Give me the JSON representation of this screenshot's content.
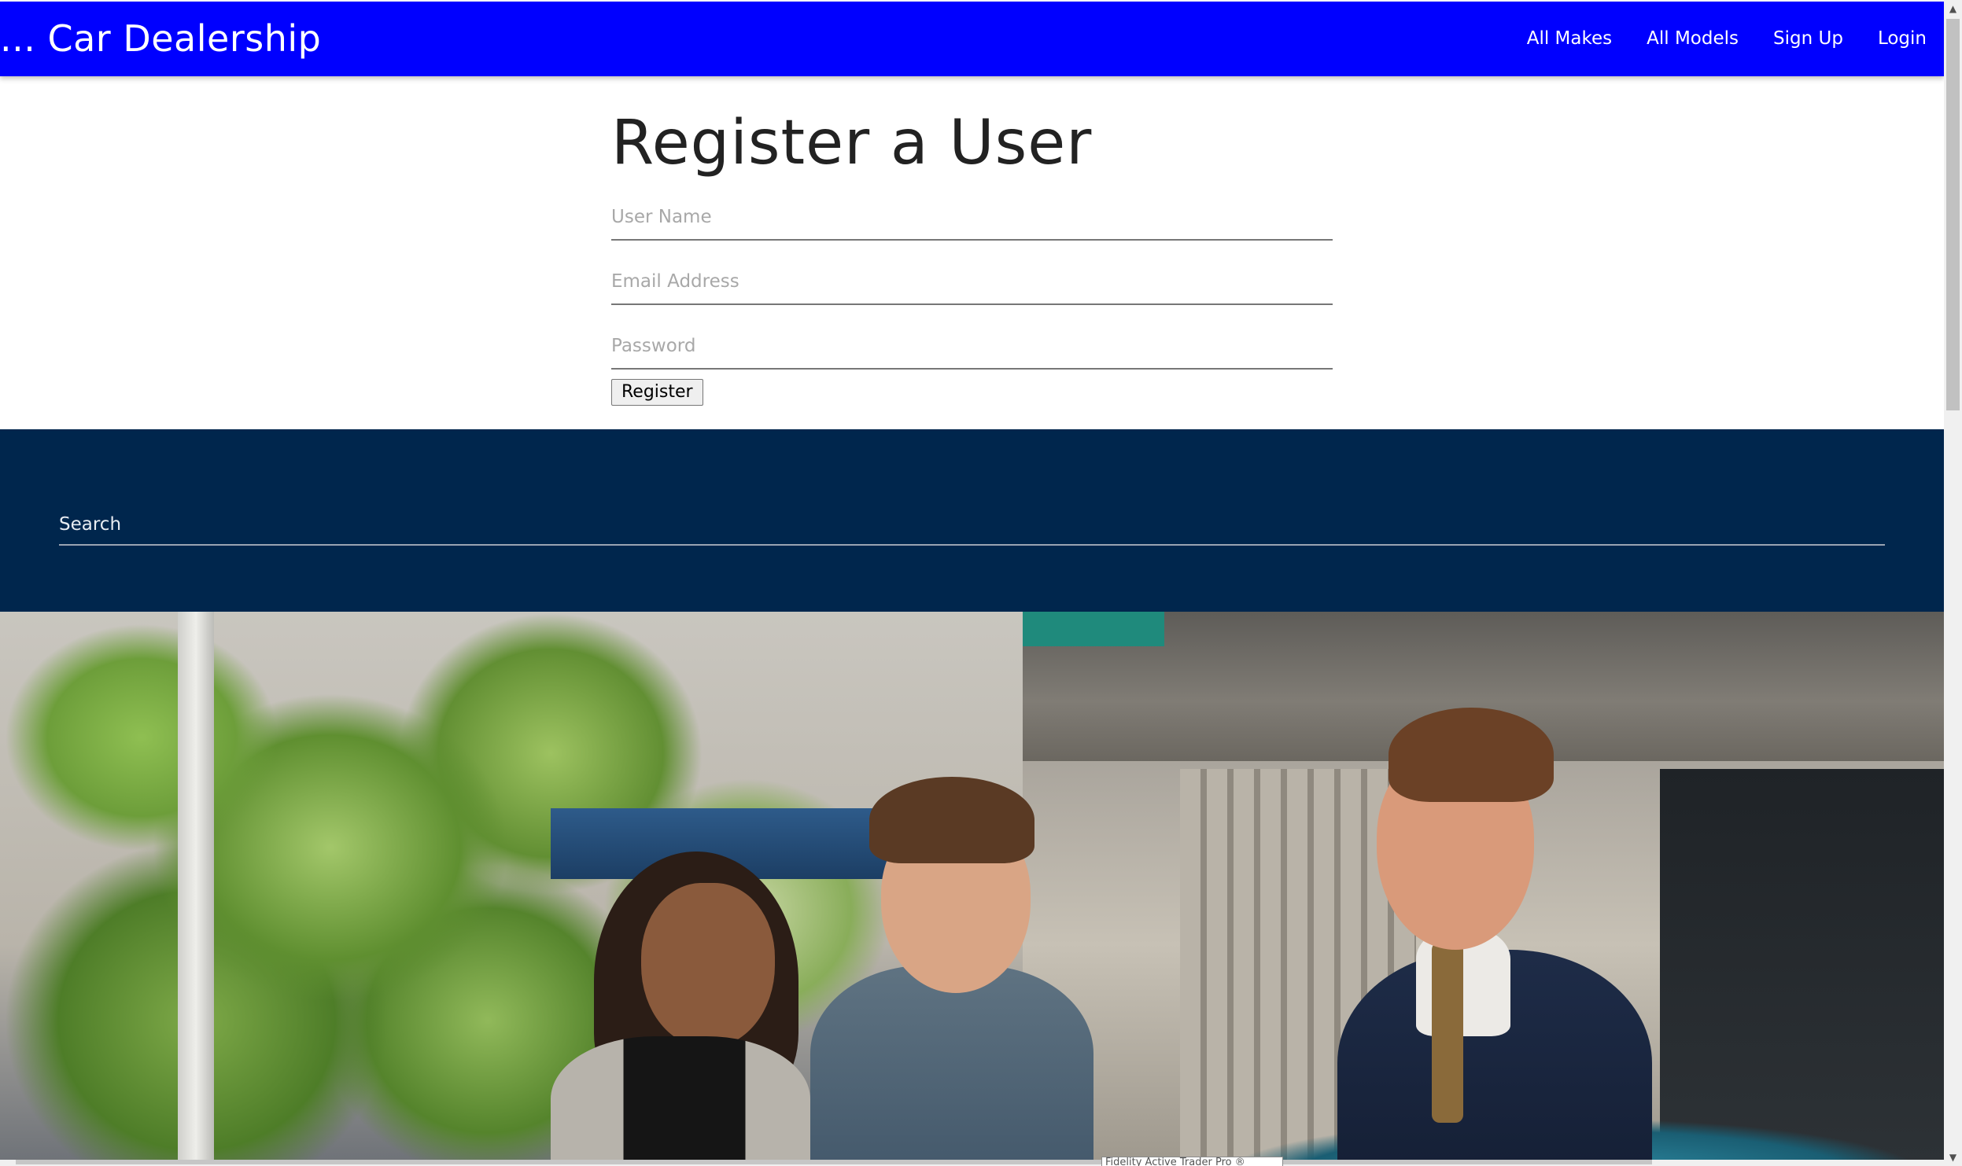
{
  "navbar": {
    "brand": "... Car Dealership",
    "links": [
      "All Makes",
      "All Models",
      "Sign Up",
      "Login"
    ],
    "background": "#0000ff"
  },
  "register": {
    "title": "Register a User",
    "username_placeholder": "User Name",
    "email_placeholder": "Email Address",
    "password_placeholder": "Password",
    "button_label": "Register"
  },
  "search": {
    "placeholder": "Search",
    "band_color": "#00264d"
  },
  "hero": {
    "image_icon": "dealership-photo"
  },
  "tooltip": {
    "text": "Fidelity Active Trader Pro ®"
  },
  "scrollbar": {
    "up_icon": "▲",
    "down_icon": "▼"
  }
}
